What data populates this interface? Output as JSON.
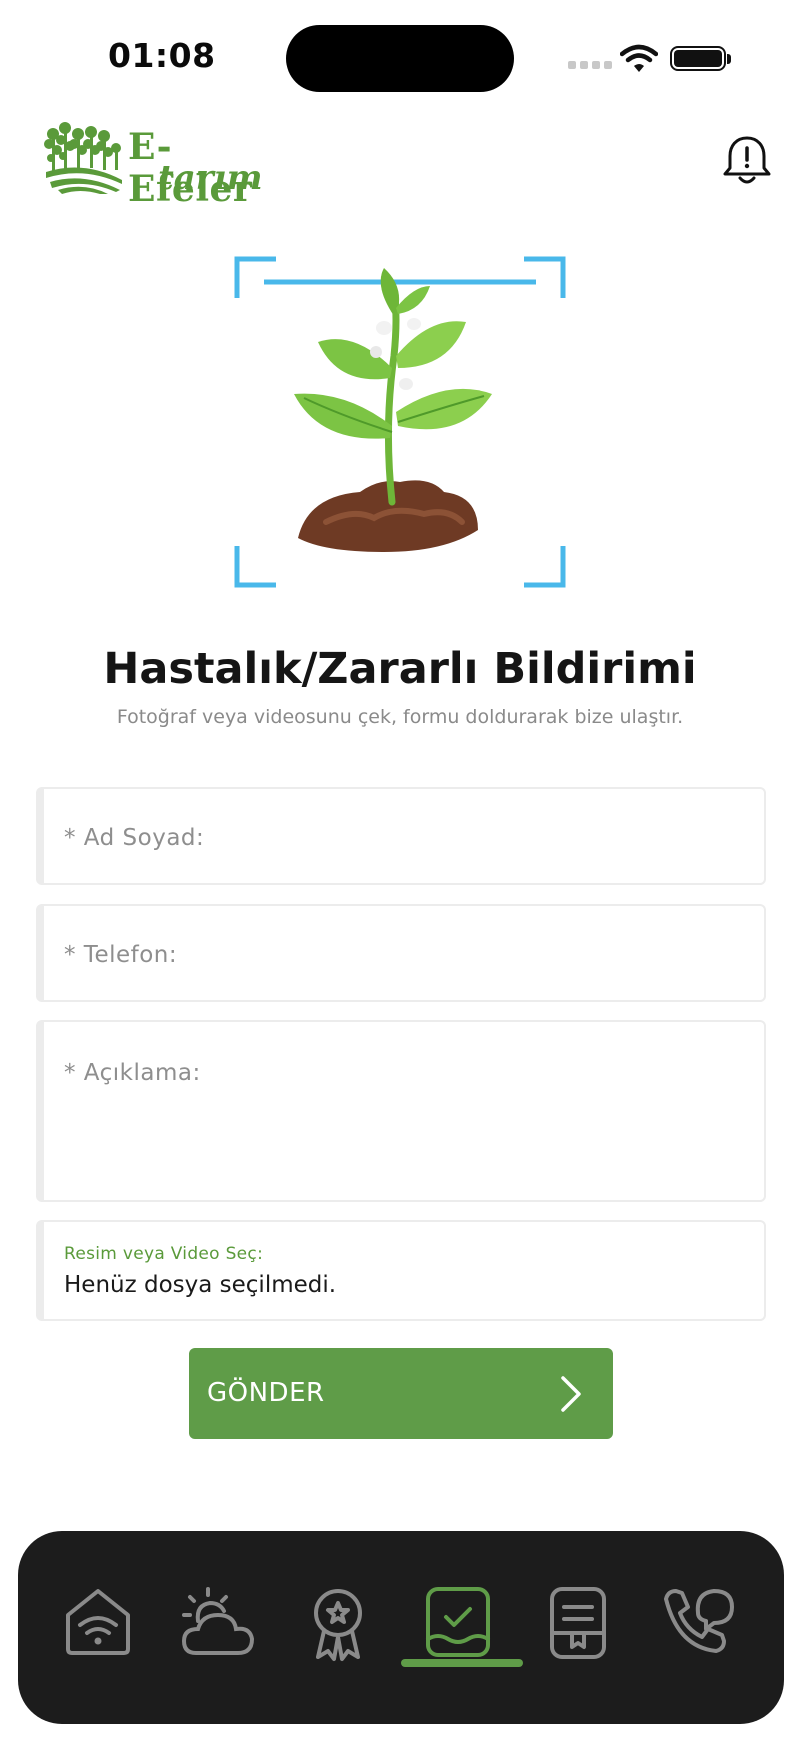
{
  "status_bar": {
    "time": "01:08"
  },
  "header": {
    "logo_title": "E-Efeler",
    "logo_subtitle": "tarım"
  },
  "hero": {
    "title": "Hastalık/Zararlı Bildirimi",
    "subtitle": "Fotoğraf veya videosunu çek, formu doldurarak bize ulaştır."
  },
  "form": {
    "name_placeholder": "* Ad Soyad:",
    "phone_placeholder": "* Telefon:",
    "description_placeholder": "* Açıklama:",
    "file_label": "Resim veya Video Seç:",
    "file_value": "Henüz dosya seçilmedi.",
    "submit_label": "GÖNDER"
  },
  "bottom_nav": {
    "items": [
      {
        "icon": "home-wifi-icon"
      },
      {
        "icon": "weather-icon"
      },
      {
        "icon": "award-icon"
      },
      {
        "icon": "report-check-icon",
        "active": true
      },
      {
        "icon": "document-icon"
      },
      {
        "icon": "phone-chat-icon"
      }
    ]
  },
  "colors": {
    "brand_green": "#5f9c48",
    "scan_frame": "#49b8ea",
    "nav_bg": "#1c1c1c"
  }
}
